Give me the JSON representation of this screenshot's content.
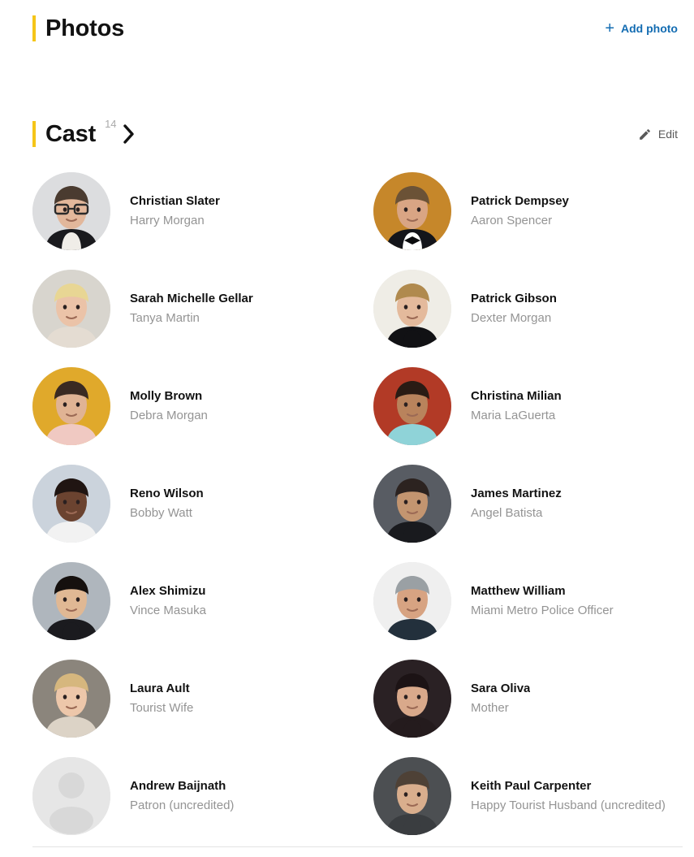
{
  "theme": {
    "accent_yellow": "#F5C518",
    "link_blue": "#136CB2",
    "name_color": "#121212",
    "role_color": "#949494",
    "divider_color": "#E3E3E3"
  },
  "photos_section": {
    "title": "Photos",
    "add_photo_label": "Add photo",
    "add_photo_icon": "plus-icon"
  },
  "cast_section": {
    "title": "Cast",
    "count": "14",
    "chevron_icon": "chevron-right-icon",
    "edit_label": "Edit",
    "edit_icon": "pencil-icon",
    "members": [
      {
        "name": "Christian Slater",
        "role": "Harry Morgan",
        "avatar": "photo-avatar"
      },
      {
        "name": "Patrick Dempsey",
        "role": "Aaron Spencer",
        "avatar": "photo-avatar"
      },
      {
        "name": "Sarah Michelle Gellar",
        "role": "Tanya Martin",
        "avatar": "photo-avatar"
      },
      {
        "name": "Patrick Gibson",
        "role": "Dexter Morgan",
        "avatar": "photo-avatar"
      },
      {
        "name": "Molly Brown",
        "role": "Debra Morgan",
        "avatar": "photo-avatar"
      },
      {
        "name": "Christina Milian",
        "role": "Maria LaGuerta",
        "avatar": "photo-avatar"
      },
      {
        "name": "Reno Wilson",
        "role": "Bobby Watt",
        "avatar": "photo-avatar"
      },
      {
        "name": "James Martinez",
        "role": "Angel Batista",
        "avatar": "photo-avatar"
      },
      {
        "name": "Alex Shimizu",
        "role": "Vince Masuka",
        "avatar": "photo-avatar"
      },
      {
        "name": "Matthew William",
        "role": "Miami Metro Police Officer",
        "avatar": "photo-avatar"
      },
      {
        "name": "Laura Ault",
        "role": "Tourist Wife",
        "avatar": "photo-avatar"
      },
      {
        "name": "Sara Oliva",
        "role": "Mother",
        "avatar": "photo-avatar"
      },
      {
        "name": "Andrew Baijnath",
        "role": "Patron (uncredited)",
        "avatar": "placeholder-person-avatar"
      },
      {
        "name": "Keith Paul Carpenter",
        "role": "Happy Tourist Husband (uncredited)",
        "avatar": "photo-avatar"
      }
    ]
  }
}
